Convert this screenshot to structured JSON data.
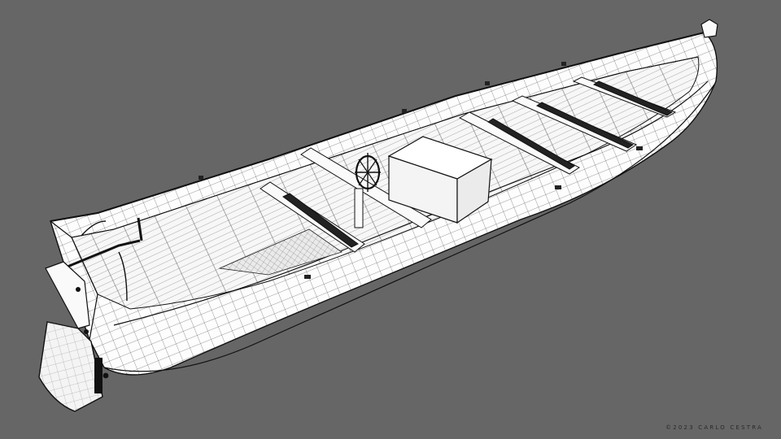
{
  "scene": {
    "subject": "boat-wireframe-render",
    "background_color": "#666666",
    "hull_color": "#ffffff",
    "line_color": "#111111"
  },
  "credit": {
    "text": "©2023 CARLO CESTRA"
  }
}
